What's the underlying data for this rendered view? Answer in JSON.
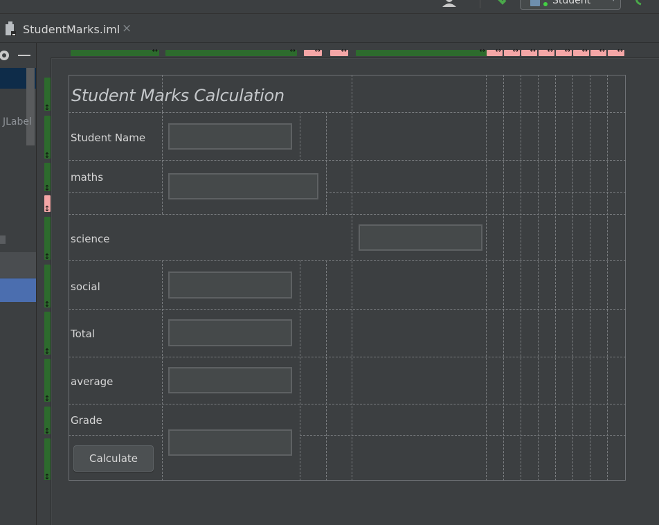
{
  "toolbar": {
    "run_config_label": "Student",
    "user_icon": "user-icon",
    "build_icon": "hammer-icon",
    "sync_icon": "sync-icon"
  },
  "tab": {
    "file_name": "StudentMarks.iml",
    "close_glyph": "×"
  },
  "palette": {
    "component_label": "JLabel",
    "settings_icon": "gear-icon",
    "minimize_icon": "minimize-icon"
  },
  "rulers": {
    "grow_arrow": "↔",
    "grow_color": "#2d6b2d",
    "fixed_color": "#f4a6a6"
  },
  "form": {
    "title": "Student Marks Calculation",
    "labels": {
      "student_name": "Student Name",
      "maths": "maths",
      "science": "science",
      "social": "social",
      "total": "Total",
      "average": "average",
      "grade": "Grade"
    },
    "fields": {
      "student_name": "",
      "maths": "",
      "science": "",
      "social": "",
      "total": "",
      "average": "",
      "grade": ""
    },
    "calculate_button": "Calculate"
  },
  "colors": {
    "background": "#3c3f41",
    "selection": "#4b6eaf",
    "field_bg": "#45494a"
  }
}
